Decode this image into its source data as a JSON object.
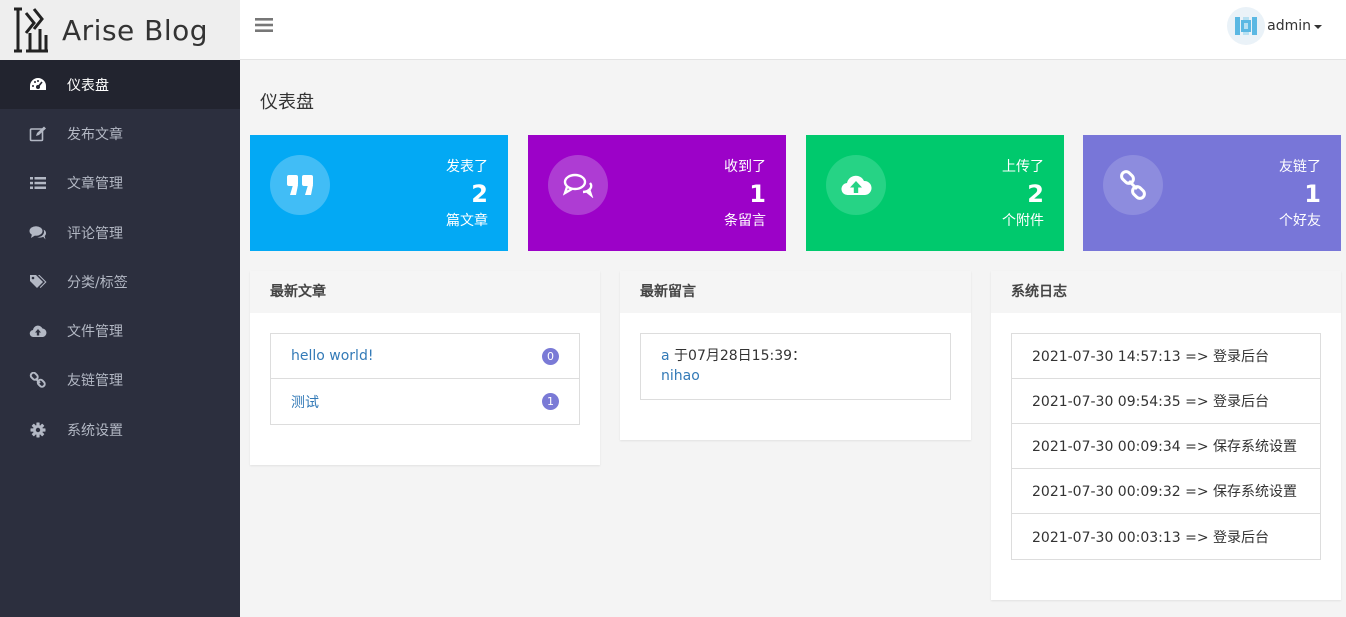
{
  "brand": {
    "name": "Arise Blog"
  },
  "sidebar": {
    "items": [
      {
        "label": "仪表盘",
        "icon": "dashboard-icon"
      },
      {
        "label": "发布文章",
        "icon": "edit-icon"
      },
      {
        "label": "文章管理",
        "icon": "list-icon"
      },
      {
        "label": "评论管理",
        "icon": "comments-icon"
      },
      {
        "label": "分类/标签",
        "icon": "tags-icon"
      },
      {
        "label": "文件管理",
        "icon": "cloud-upload-icon"
      },
      {
        "label": "友链管理",
        "icon": "link-icon"
      },
      {
        "label": "系统设置",
        "icon": "gear-icon"
      }
    ]
  },
  "topbar": {
    "username": "admin"
  },
  "page": {
    "title": "仪表盘"
  },
  "stats": [
    {
      "top": "发表了",
      "value": "2",
      "bottom": "篇文章",
      "color": "#03a9f4",
      "icon": "quote-icon"
    },
    {
      "top": "收到了",
      "value": "1",
      "bottom": "条留言",
      "color": "#9c02c8",
      "icon": "comments-icon"
    },
    {
      "top": "上传了",
      "value": "2",
      "bottom": "个附件",
      "color": "#00c96d",
      "icon": "cloud-upload-icon"
    },
    {
      "top": "友链了",
      "value": "1",
      "bottom": "个好友",
      "color": "#7876d8",
      "icon": "link-icon"
    }
  ],
  "latest_posts": {
    "title": "最新文章",
    "items": [
      {
        "title": "hello world!",
        "count": "0"
      },
      {
        "title": "测试",
        "count": "1"
      }
    ]
  },
  "latest_comments": {
    "title": "最新留言",
    "items": [
      {
        "author": "a",
        "meta": " 于07月28日15:39：",
        "content": "nihao"
      }
    ]
  },
  "system_log": {
    "title": "系统日志",
    "items": [
      "2021-07-30 14:57:13 => 登录后台",
      "2021-07-30 09:54:35 => 登录后台",
      "2021-07-30 00:09:34 => 保存系统设置",
      "2021-07-30 00:09:32 => 保存系统设置",
      "2021-07-30 00:03:13 => 登录后台"
    ]
  }
}
